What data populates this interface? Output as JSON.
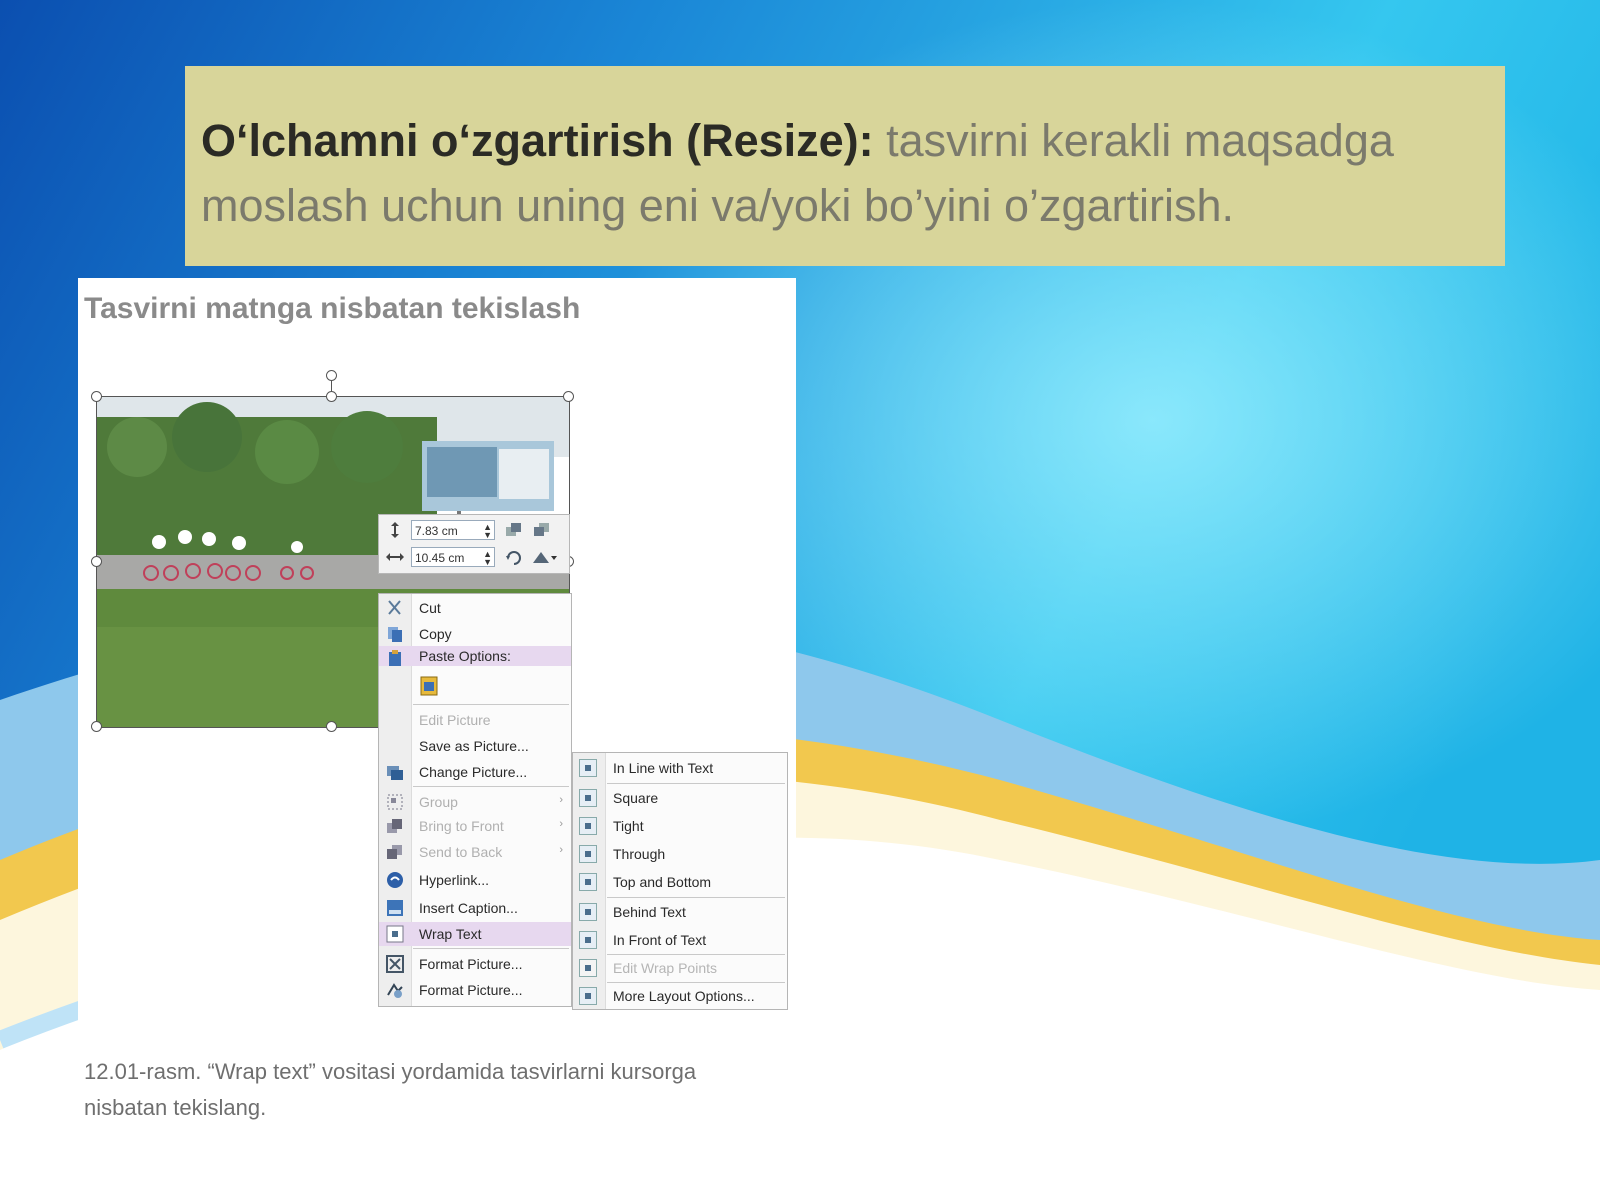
{
  "slide": {
    "heading_bold": "O‘lchamni o‘zgartirish (Resize):",
    "heading_text": "tasvirni kerakli maqsadga moslash uchun uning eni va/yoki bo’yini o’zgartirish."
  },
  "panel": {
    "title": "Tasvirni matnga nisbatan tekislash",
    "caption": "12.01-rasm. “Wrap text” vositasi yordamida tasvirlarni kursorga nisbatan tekislang."
  },
  "size_toolbar": {
    "height_value": "7.83 cm",
    "width_value": "10.45 cm",
    "height_icon": "height-icon",
    "width_icon": "width-icon"
  },
  "context_menu": {
    "items": [
      {
        "label": "Cut",
        "icon": "scissors-icon",
        "enabled": true
      },
      {
        "label": "Copy",
        "icon": "copy-icon",
        "enabled": true
      },
      {
        "label": "Paste Options:",
        "icon": "paste-icon",
        "enabled": true
      },
      {
        "label": "Edit Picture",
        "enabled": false
      },
      {
        "label": "Save as Picture...",
        "enabled": true
      },
      {
        "label": "Change Picture...",
        "icon": "change-picture-icon",
        "enabled": true
      },
      {
        "label": "Group",
        "icon": "group-icon",
        "enabled": false
      },
      {
        "label": "Bring to Front",
        "icon": "bring-front-icon",
        "enabled": false
      },
      {
        "label": "Send to Back",
        "icon": "send-back-icon",
        "enabled": false
      },
      {
        "label": "Hyperlink...",
        "icon": "hyperlink-icon",
        "enabled": true
      },
      {
        "label": "Insert Caption...",
        "icon": "caption-icon",
        "enabled": true
      },
      {
        "label": "Wrap Text",
        "icon": "wrap-text-icon",
        "enabled": true
      },
      {
        "label": "Format Picture...",
        "icon": "format-picture-icon",
        "enabled": true
      },
      {
        "label": "Format Picture...",
        "icon": "format-shape-icon",
        "enabled": true
      }
    ]
  },
  "wrap_submenu": {
    "items": [
      {
        "label": "In Line with Text",
        "enabled": true
      },
      {
        "label": "Square",
        "enabled": true
      },
      {
        "label": "Tight",
        "enabled": true
      },
      {
        "label": "Through",
        "enabled": true
      },
      {
        "label": "Top and Bottom",
        "enabled": true
      },
      {
        "label": "Behind Text",
        "enabled": true
      },
      {
        "label": "In Front of Text",
        "enabled": true
      },
      {
        "label": "Edit Wrap Points",
        "enabled": false
      },
      {
        "label": "More Layout Options...",
        "enabled": true
      }
    ]
  },
  "colors": {
    "callout_bg": "#d8d59a",
    "menu_highlight": "#e7d8ef",
    "bg_blue": "#1f86d4",
    "bg_cyan": "#38d8f2",
    "wave_gold": "#f2c84e"
  }
}
